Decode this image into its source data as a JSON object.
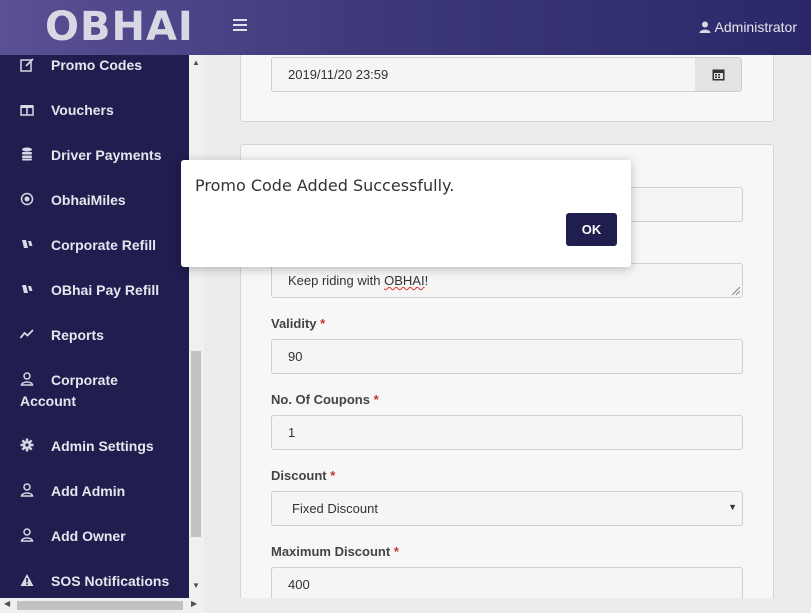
{
  "header": {
    "logo": "OBHAI",
    "user_label": "Administrator"
  },
  "sidebar": {
    "items": [
      {
        "label": "Promo Codes",
        "icon": "edit-icon"
      },
      {
        "label": "Vouchers",
        "icon": "gift-icon"
      },
      {
        "label": "Driver Payments",
        "icon": "database-icon"
      },
      {
        "label": "ObhaiMiles",
        "icon": "target-icon"
      },
      {
        "label": "Corporate Refill",
        "icon": "wallet-icon"
      },
      {
        "label": "OBhai Pay Refill",
        "icon": "wallet-icon"
      },
      {
        "label": "Reports",
        "icon": "line-chart-icon"
      },
      {
        "label": "Corporate",
        "label2": "Account",
        "icon": "user-icon"
      },
      {
        "label": "Admin Settings",
        "icon": "gear-icon"
      },
      {
        "label": "Add Admin",
        "icon": "user-icon"
      },
      {
        "label": "Add Owner",
        "icon": "user-icon"
      },
      {
        "label": "SOS Notifications",
        "icon": "warning-icon"
      }
    ]
  },
  "form": {
    "expiry_value": "2019/11/20 23:59",
    "message_value_prefix": "Keep riding with ",
    "message_value_brand": "OBHAI",
    "message_value_suffix": "!",
    "validity_label": "Validity",
    "validity_value": "90",
    "coupons_label": "No. Of Coupons",
    "coupons_value": "1",
    "discount_label": "Discount",
    "discount_value": "Fixed Discount",
    "max_discount_label": "Maximum Discount",
    "max_discount_value": "400",
    "required_mark": "*"
  },
  "modal": {
    "message": "Promo Code Added Successfully.",
    "ok_label": "OK"
  },
  "colors": {
    "sidebar_bg": "#201d4f",
    "ok_button": "#201d4f",
    "required": "#c0392b"
  }
}
